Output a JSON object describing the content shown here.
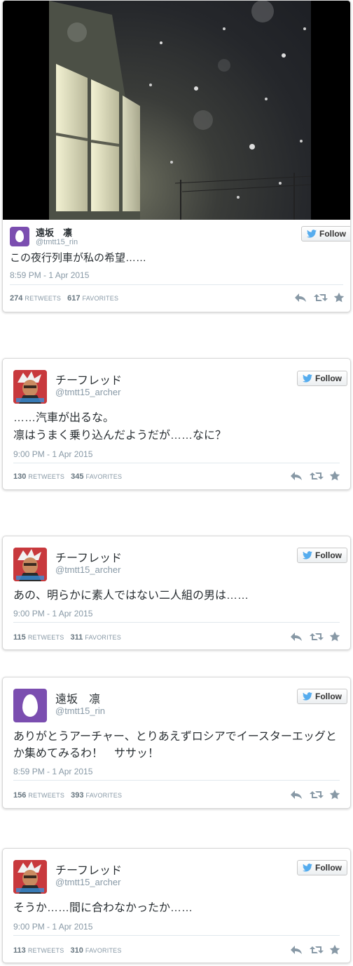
{
  "colors": {
    "twitter_blue": "#55acee",
    "egg_purple": "#7b4eb0",
    "text": "#292f33",
    "muted": "#8899a6"
  },
  "follow_label": "Follow",
  "stat_labels": {
    "retweets": "RETWEETS",
    "favorites": "FAVORITES"
  },
  "icons": {
    "reply": "reply-icon",
    "retweet": "retweet-icon",
    "favorite": "star-icon",
    "follow": "twitter-bird-icon"
  },
  "tweets": [
    {
      "name": "遠坂　凛",
      "handle": "@tmtt15_rin",
      "avatar": "egg",
      "lines": [
        "この夜行列車が私の希望……"
      ],
      "time": "8:59 PM - 1 Apr 2015",
      "retweets": "274",
      "favorites": "617",
      "has_media": true
    },
    {
      "name": "チーフレッド",
      "handle": "@tmtt15_archer",
      "avatar": "anime",
      "lines": [
        "……汽車が出るな。",
        "凛はうまく乗り込んだようだが……なに？"
      ],
      "time": "9:00 PM - 1 Apr 2015",
      "retweets": "130",
      "favorites": "345"
    },
    {
      "name": "チーフレッド",
      "handle": "@tmtt15_archer",
      "avatar": "anime",
      "lines": [
        "あの、明らかに素人ではない二人組の男は……"
      ],
      "time": "9:00 PM - 1 Apr 2015",
      "retweets": "115",
      "favorites": "311"
    },
    {
      "name": "遠坂　凛",
      "handle": "@tmtt15_rin",
      "avatar": "egg",
      "lines": [
        "ありがとうアーチャー、とりあえずロシアでイースターエッグと",
        "か集めてみるわ！　ササッ！"
      ],
      "time": "8:59 PM - 1 Apr 2015",
      "retweets": "156",
      "favorites": "393"
    },
    {
      "name": "チーフレッド",
      "handle": "@tmtt15_archer",
      "avatar": "anime",
      "lines": [
        "そうか……間に合わなかったか……"
      ],
      "time": "9:00 PM - 1 Apr 2015",
      "retweets": "113",
      "favorites": "310"
    }
  ]
}
